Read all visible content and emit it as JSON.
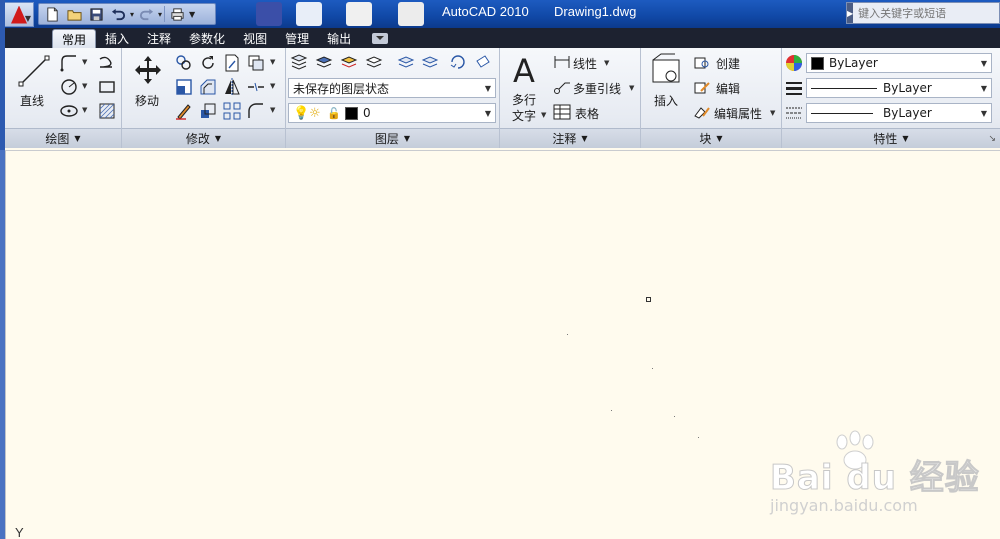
{
  "titlebar": {
    "app_name": "AutoCAD 2010",
    "document": "Drawing1.dwg",
    "search_placeholder": "键入关键字或短语"
  },
  "tabs": [
    "常用",
    "插入",
    "注释",
    "参数化",
    "视图",
    "管理",
    "输出"
  ],
  "active_tab": "常用",
  "panels": {
    "draw": {
      "title": "绘图",
      "line_label": "直线"
    },
    "modify": {
      "title": "修改",
      "move_label": "移动"
    },
    "layers": {
      "title": "图层",
      "layer_state": "未保存的图层状态",
      "current_layer": "0"
    },
    "annotation": {
      "title": "注释",
      "mtext_label_1": "多行",
      "mtext_label_2": "文字",
      "linear_label": "线性",
      "mleader_label": "多重引线",
      "table_label": "表格"
    },
    "block": {
      "title": "块",
      "insert_label": "插入",
      "create_label": "创建",
      "edit_label": "编辑",
      "edit_attr_label": "编辑属性"
    },
    "properties": {
      "title": "特性",
      "color_value": "ByLayer",
      "linetype_value": "ByLayer",
      "lineweight_value": "ByLayer"
    }
  },
  "canvas": {
    "ucs_axis_label": "Y"
  },
  "watermark": {
    "main": "Bai du 经验",
    "sub": "jingyan.baidu.com"
  },
  "colors": {
    "titlebar": "#1048a6",
    "tabbar": "#1d2230",
    "canvas_bg": "#fffbee",
    "accent_red": "#d11a1a"
  }
}
